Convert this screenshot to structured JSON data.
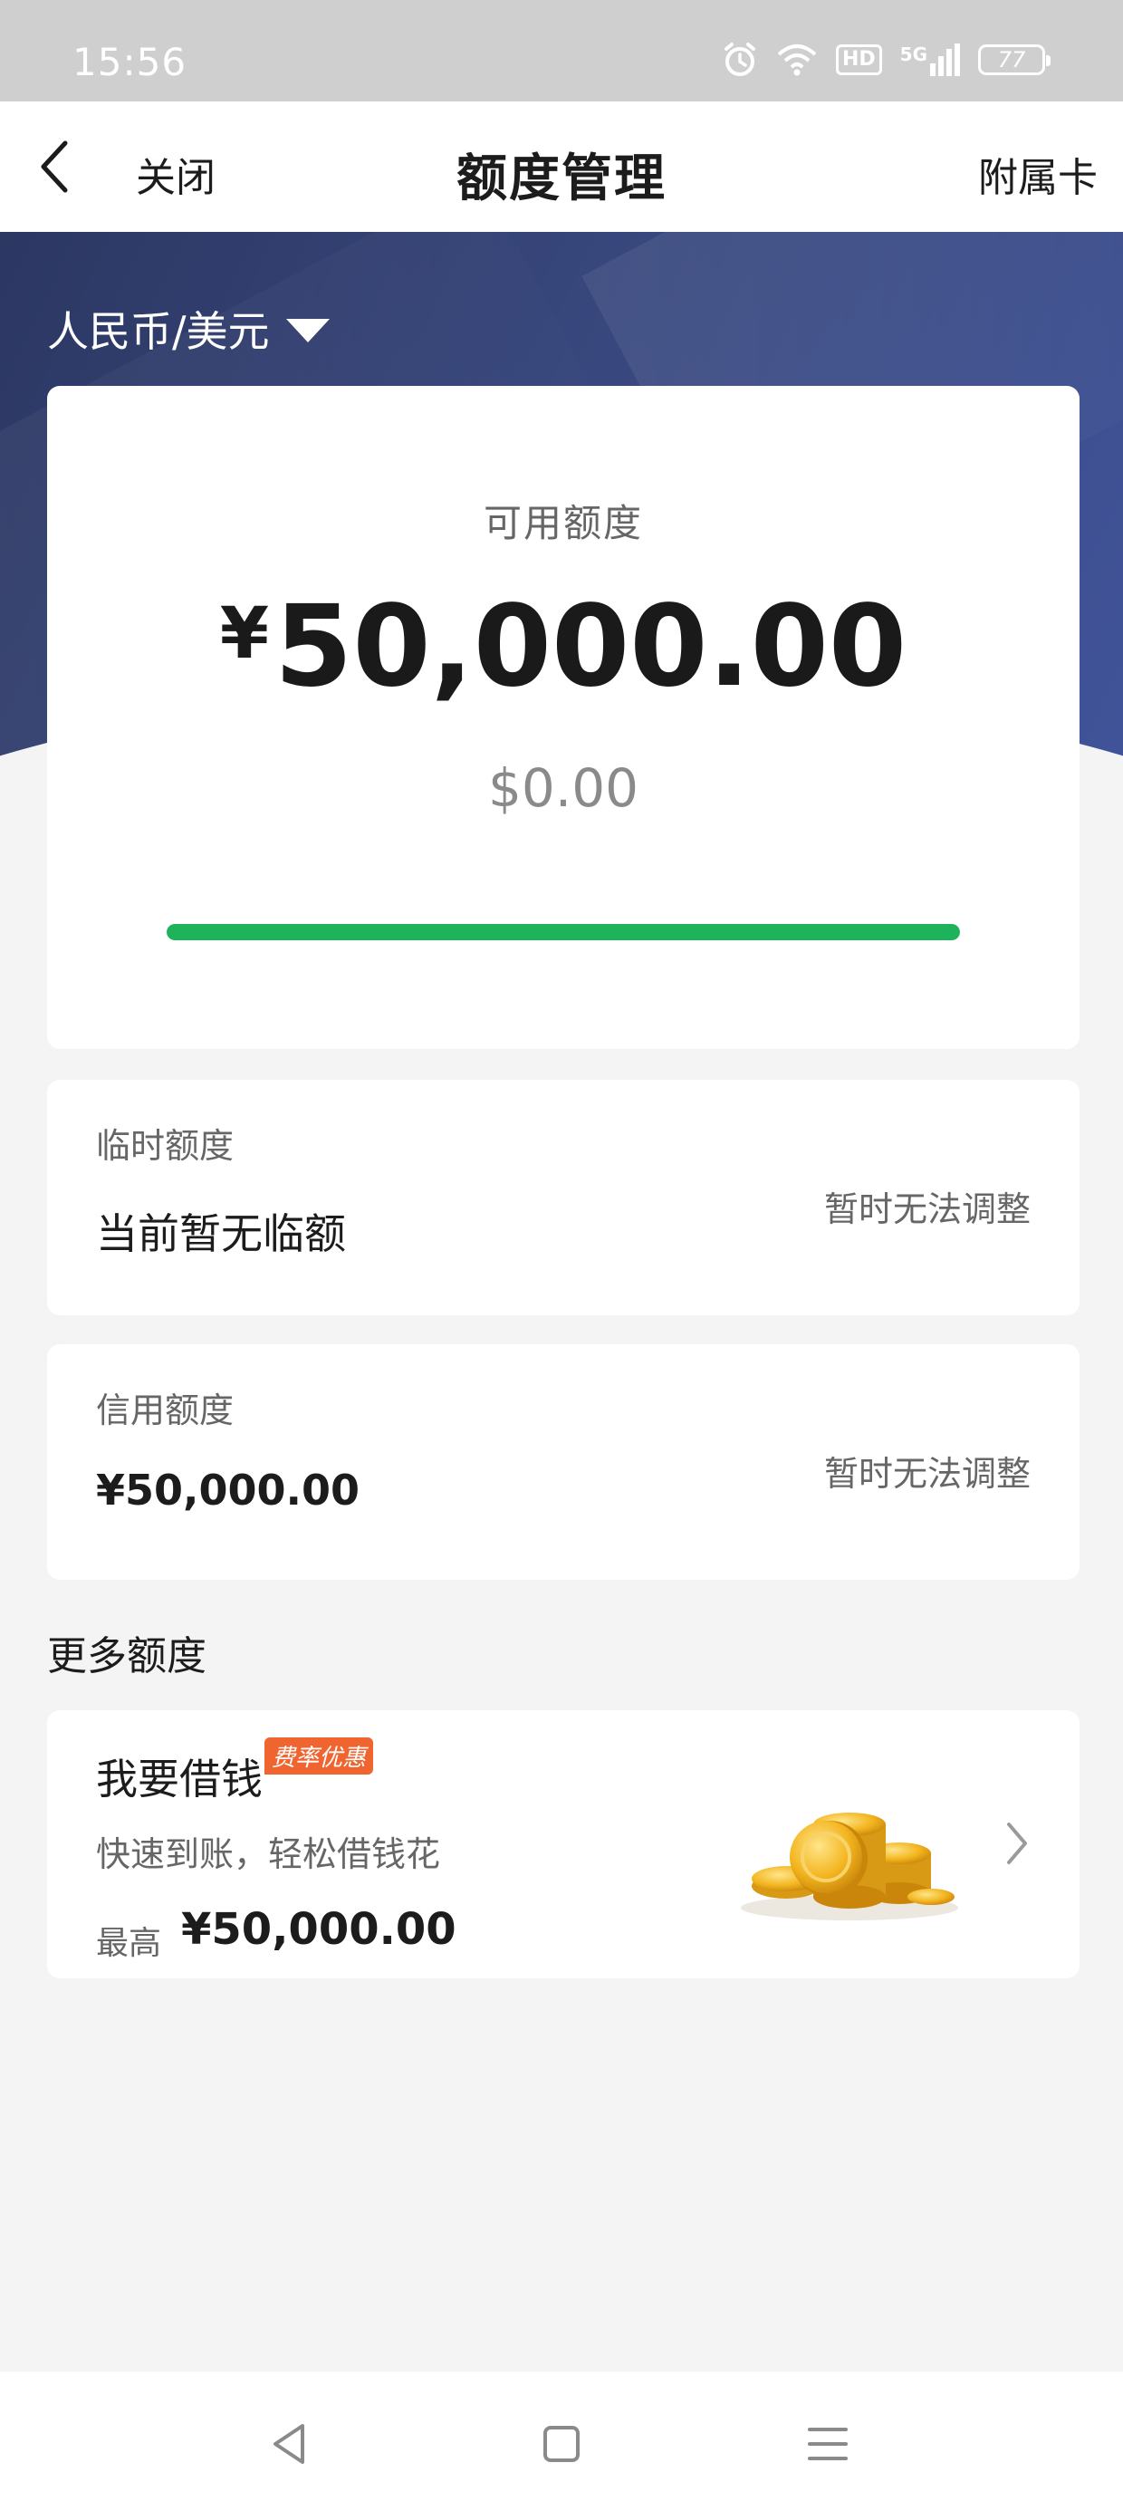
{
  "status_bar": {
    "time": "15:56",
    "network_label": "5G",
    "hd_label": "HD",
    "battery": "77",
    "icons": [
      "alarm-icon",
      "wifi-icon",
      "hd-icon",
      "signal-5g-icon",
      "battery-icon"
    ]
  },
  "nav": {
    "back_icon": "chevron-left-icon",
    "close_label": "关闭",
    "title": "额度管理",
    "right_label": "附属卡"
  },
  "currency_selector": {
    "label": "人民币/美元",
    "icon": "caret-down-icon"
  },
  "available": {
    "label": "可用额度",
    "currency_symbol": "¥",
    "amount": "50,000.00",
    "usd_amount": "$0.00",
    "progress_fraction": 1.0,
    "progress_color": "#1eb35a"
  },
  "temporary_limit": {
    "label": "临时额度",
    "value": "当前暂无临额",
    "action": "暂时无法调整"
  },
  "credit_limit": {
    "label": "信用额度",
    "value": "¥50,000.00",
    "action": "暂时无法调整"
  },
  "more": {
    "section_title": "更多额度",
    "loan": {
      "title": "我要借钱",
      "tag": "费率优惠",
      "description": "快速到账，轻松借钱花",
      "max_label": "最高",
      "max_value": "¥50,000.00",
      "image_icon": "gold-coins-icon",
      "arrow_icon": "chevron-right-icon"
    }
  },
  "colors": {
    "header_gradient_start": "#2c3762",
    "header_gradient_end": "#41549a",
    "accent_green": "#1eb35a",
    "tag_orange": "#f0642f"
  },
  "system_nav": {
    "icons": [
      "back-triangle-icon",
      "home-square-icon",
      "menu-lines-icon"
    ]
  }
}
